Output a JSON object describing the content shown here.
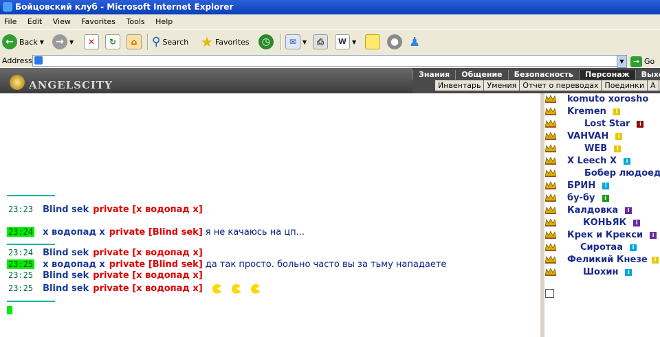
{
  "window": {
    "title": "Бойцовский клуб - Microsoft Internet Explorer"
  },
  "menu": [
    "File",
    "Edit",
    "View",
    "Favorites",
    "Tools",
    "Help"
  ],
  "toolbar": {
    "back": "Back",
    "search": "Search",
    "favorites": "Favorites"
  },
  "address": {
    "label": "Address",
    "value": "",
    "go": "Go"
  },
  "site": {
    "logo": "ANGELSCITY",
    "nav_top": [
      "Знания",
      "Общение",
      "Безопасность",
      "Персонаж",
      "Выхо"
    ],
    "nav_top_active_index": 3,
    "nav_sub": [
      "Инвентарь",
      "Умения",
      "Отчет о переводах",
      "Поединки",
      "А"
    ]
  },
  "chat": {
    "messages": [
      {
        "time": "23:23",
        "time_highlight": false,
        "from": "Blind sek",
        "to": "private [x водопад x]",
        "text": ""
      },
      {
        "time": "23:24",
        "time_highlight": true,
        "from": "x водопад x",
        "to": "private [Blind sek]",
        "text": "я не качаюсь на цп..."
      },
      {
        "time": "23:24",
        "time_highlight": false,
        "from": "Blind sek",
        "to": "private [x водопад x]",
        "text": ""
      },
      {
        "time": "23:25",
        "time_highlight": true,
        "from": "x водопад x",
        "to": "private [Blind sek]",
        "text": "да так просто. больно часто вы за тьму нападаете"
      },
      {
        "time": "23:25",
        "time_highlight": false,
        "from": "Blind sek",
        "to": "private [x водопад x]",
        "text": ""
      },
      {
        "time": "23:25",
        "time_highlight": false,
        "from": "Blind sek",
        "to": "private [x водопад x]",
        "text": ""
      }
    ]
  },
  "online": {
    "users": [
      {
        "name": "komuto xorosho",
        "badge": "",
        "badge_color": ""
      },
      {
        "name": "Kremen",
        "badge": "i",
        "badge_color": "yellow"
      },
      {
        "name": "Lost Star",
        "badge": "i",
        "badge_color": "darkred"
      },
      {
        "name": "VAHVAH",
        "badge": "i",
        "badge_color": "yellow"
      },
      {
        "name": "WEB",
        "badge": "i",
        "badge_color": "yellow"
      },
      {
        "name": "X Leech X",
        "badge": "i",
        "badge_color": "cyan"
      },
      {
        "name": "Бобер людоед",
        "badge": "",
        "badge_color": ""
      },
      {
        "name": "БРИН",
        "badge": "i",
        "badge_color": "cyan"
      },
      {
        "name": "бу-бу",
        "badge": "i",
        "badge_color": "green"
      },
      {
        "name": "Калдовка",
        "badge": "i",
        "badge_color": "purple"
      },
      {
        "name": "КОНЬЯК",
        "badge": "i",
        "badge_color": "purple"
      },
      {
        "name": "Крек и Крекси",
        "badge": "i",
        "badge_color": "purple"
      },
      {
        "name": "Сиротаа",
        "badge": "i",
        "badge_color": "cyan"
      },
      {
        "name": "Феликий Кнезе",
        "badge": "i",
        "badge_color": "yellow"
      },
      {
        "name": "Шохин",
        "badge": "i",
        "badge_color": "cyan"
      }
    ]
  }
}
